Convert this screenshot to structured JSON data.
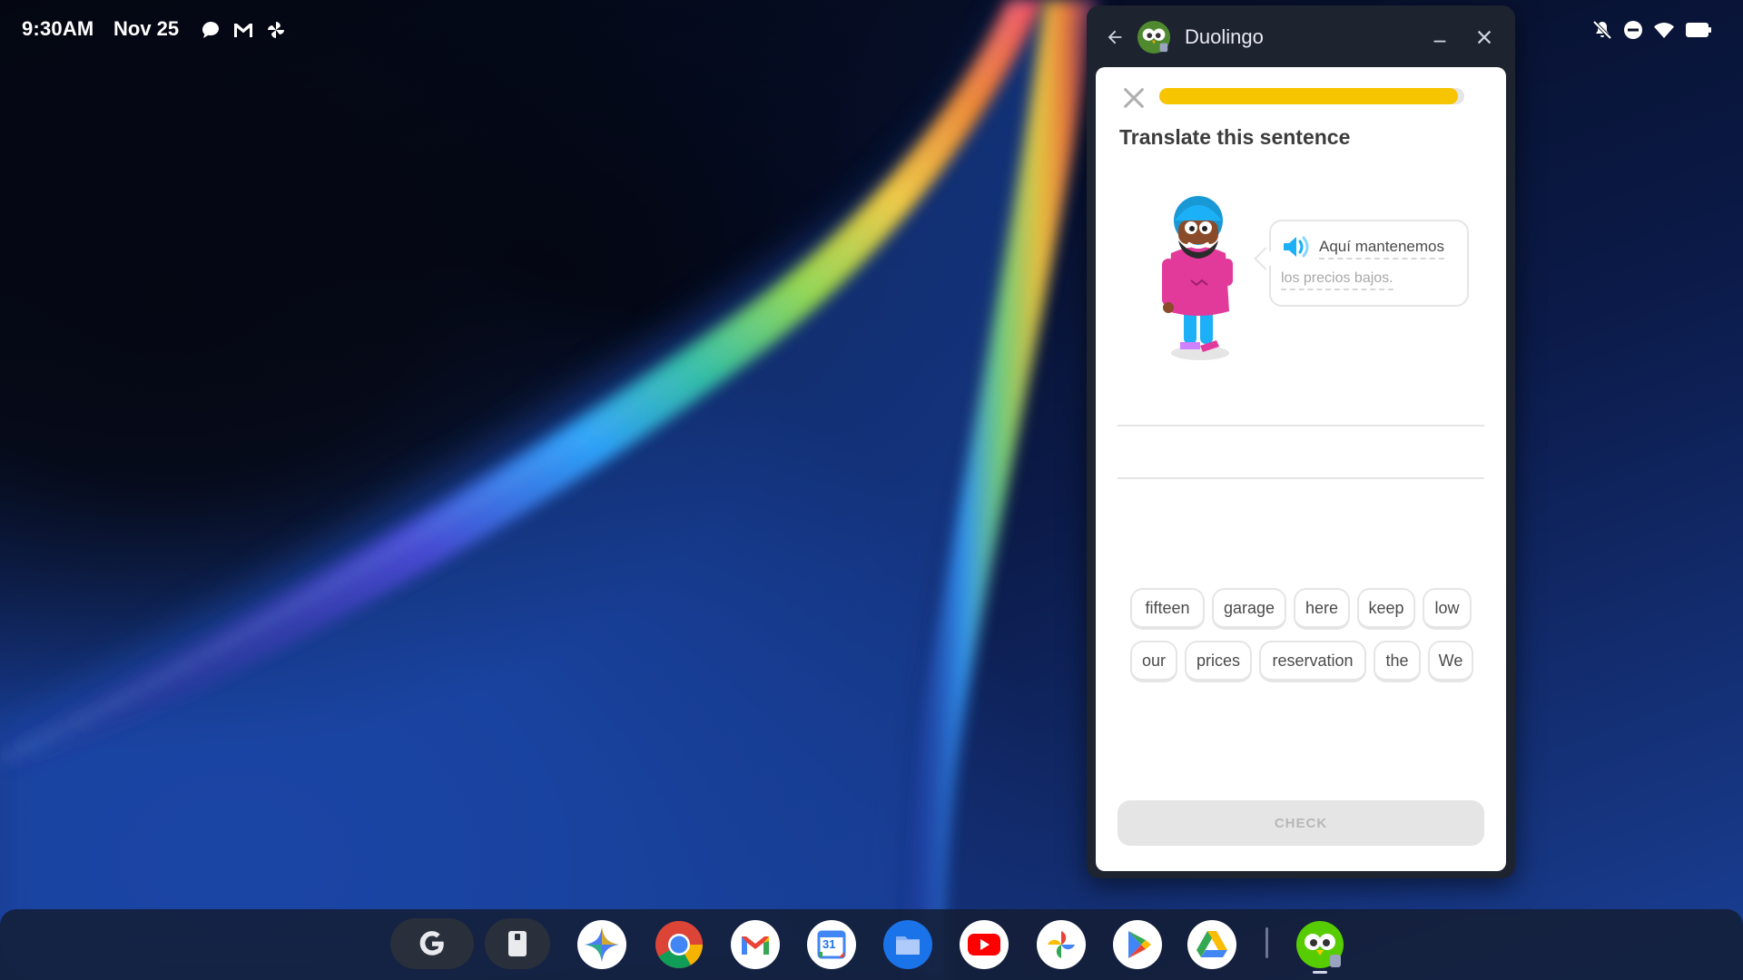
{
  "status_bar": {
    "time": "9:30AM",
    "date": "Nov 25",
    "left_icons": [
      "messages-icon",
      "gmail-icon",
      "pinwheel-icon"
    ],
    "right_icons": [
      "notifications-off-icon",
      "do-not-disturb-icon",
      "wifi-icon",
      "battery-icon"
    ]
  },
  "window": {
    "title": "Duolingo",
    "controls": [
      "back-arrow-icon",
      "minimize-icon",
      "close-icon"
    ]
  },
  "lesson": {
    "progress": 0.98,
    "prompt": "Translate this sentence",
    "sentence_line1": "Aquí mantenemos",
    "sentence_line2": "los precios bajos.",
    "word_bank_row1": [
      "fifteen",
      "garage",
      "here",
      "keep",
      "low"
    ],
    "word_bank_row2": [
      "our",
      "prices",
      "reservation",
      "the",
      "We"
    ],
    "check_label": "CHECK"
  },
  "shelf": {
    "apps": [
      "google-launcher",
      "clipboard",
      "gemini",
      "chrome",
      "gmail",
      "calendar",
      "files",
      "youtube",
      "photos",
      "play-store",
      "drive",
      "duolingo"
    ],
    "calendar_day": "31"
  },
  "colors": {
    "progress_fill": "#f7c500",
    "duolingo_green": "#58cc02",
    "window_frame": "#1e2330"
  }
}
